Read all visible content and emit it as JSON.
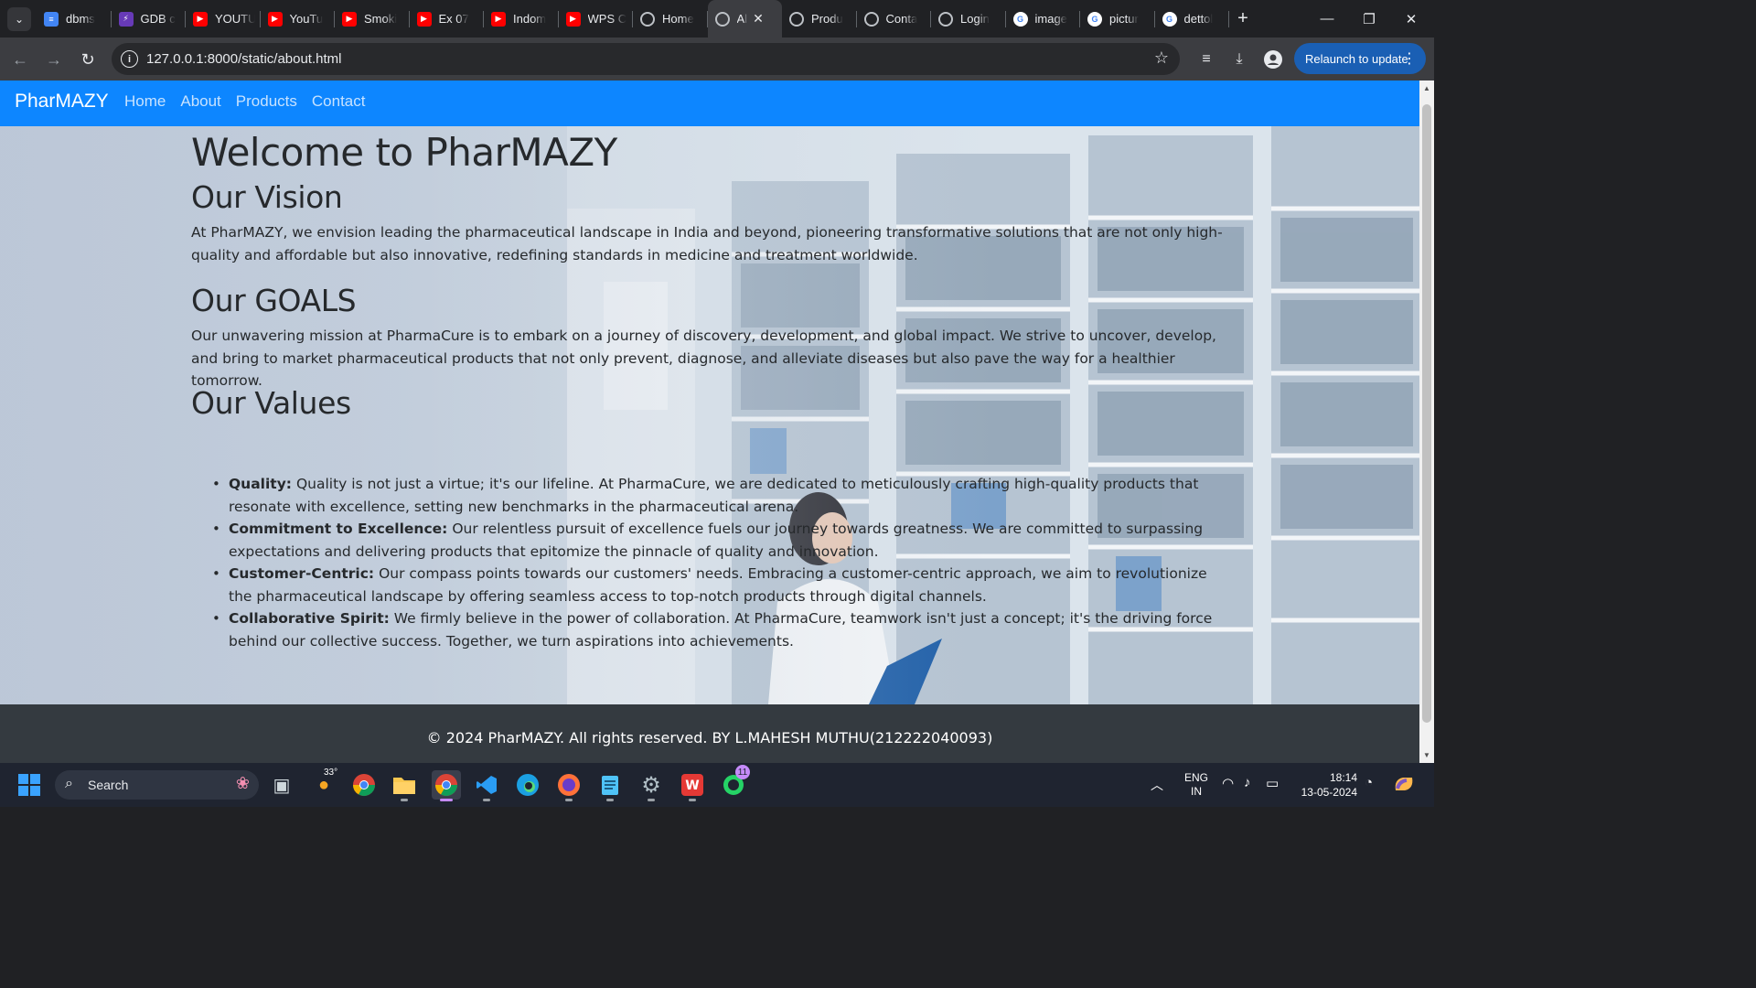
{
  "browser": {
    "tabs": [
      {
        "title": "dbms",
        "icon": "docs-icon",
        "active": false
      },
      {
        "title": "GDB c",
        "icon": "gdb-icon",
        "active": false
      },
      {
        "title": "YOUTU",
        "icon": "youtube-icon",
        "active": false
      },
      {
        "title": "YouTu",
        "icon": "youtube-icon",
        "active": false
      },
      {
        "title": "Smoki",
        "icon": "youtube-icon",
        "active": false
      },
      {
        "title": "Ex 07",
        "icon": "youtube-icon",
        "active": false
      },
      {
        "title": "Indom",
        "icon": "youtube-icon",
        "active": false
      },
      {
        "title": "WPS C",
        "icon": "youtube-icon",
        "active": false
      },
      {
        "title": "Home",
        "icon": "globe-icon",
        "active": false
      },
      {
        "title": "Al",
        "icon": "globe-icon",
        "active": true
      },
      {
        "title": "Produ",
        "icon": "globe-icon",
        "active": false
      },
      {
        "title": "Conta",
        "icon": "globe-icon",
        "active": false
      },
      {
        "title": "Login",
        "icon": "globe-icon",
        "active": false
      },
      {
        "title": "image",
        "icon": "google-icon",
        "active": false
      },
      {
        "title": "pictur",
        "icon": "google-icon",
        "active": false
      },
      {
        "title": "dettol",
        "icon": "google-icon",
        "active": false
      }
    ],
    "url": "127.0.0.1:8000/static/about.html",
    "relaunch_label": "Relaunch to update"
  },
  "page": {
    "navbar": {
      "brand": "PharMAZY",
      "links": [
        "Home",
        "About",
        "Products",
        "Contact"
      ]
    },
    "welcome_title": "Welcome to PharMAZY",
    "vision": {
      "heading": "Our Vision",
      "text": "At PharMAZY, we envision leading the pharmaceutical landscape in India and beyond, pioneering transformative solutions that are not only high-quality and affordable but also innovative, redefining standards in medicine and treatment worldwide."
    },
    "goals": {
      "heading": "Our GOALS",
      "text": "Our unwavering mission at PharmaCure is to embark on a journey of discovery, development, and global impact. We strive to uncover, develop, and bring to market pharmaceutical products that not only prevent, diagnose, and alleviate diseases but also pave the way for a healthier tomorrow."
    },
    "values": {
      "heading": "Our Values",
      "items": [
        {
          "title": "Quality:",
          "text": "Quality is not just a virtue; it's our lifeline. At PharmaCure, we are dedicated to meticulously crafting high-quality products that resonate with excellence, setting new benchmarks in the pharmaceutical arena."
        },
        {
          "title": "Commitment to Excellence:",
          "text": "Our relentless pursuit of excellence fuels our journey towards greatness. We are committed to surpassing expectations and delivering products that epitomize the pinnacle of quality and innovation."
        },
        {
          "title": "Customer-Centric:",
          "text": "Our compass points towards our customers' needs. Embracing a customer-centric approach, we aim to revolutionize the pharmaceutical landscape by offering seamless access to top-notch products through digital channels."
        },
        {
          "title": "Collaborative Spirit:",
          "text": "We firmly believe in the power of collaboration. At PharmaCure, teamwork isn't just a concept; it's the driving force behind our collective success. Together, we turn aspirations into achievements."
        }
      ]
    },
    "footer": "© 2024 PharMAZY. All rights reserved. BY L.MAHESH MUTHU(212222040093)"
  },
  "taskbar": {
    "search_label": "Search",
    "weather_temp": "33°",
    "whatsapp_badge": "11",
    "lang_top": "ENG",
    "lang_bottom": "IN",
    "time": "18:14",
    "date": "13-05-2024"
  }
}
